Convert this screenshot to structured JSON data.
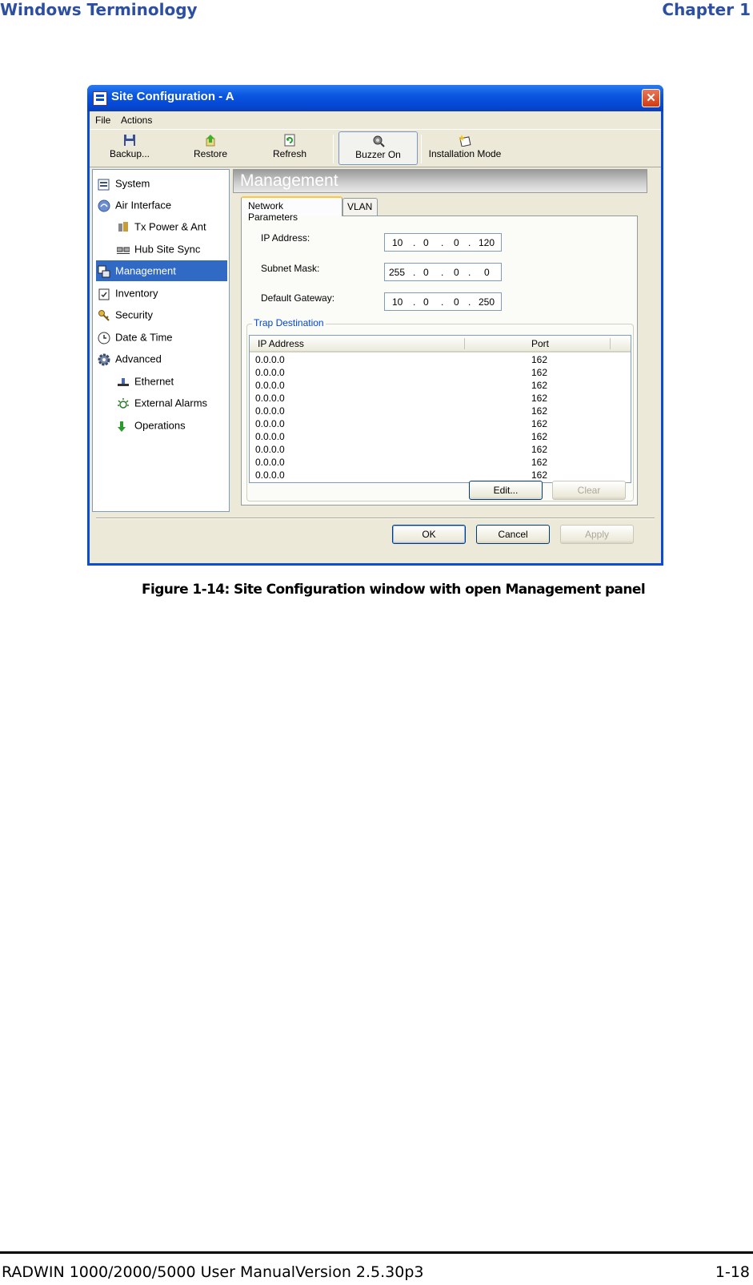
{
  "doc": {
    "header_left": "Windows Terminology",
    "header_right": "Chapter 1",
    "caption": "Figure 1-14: Site Configuration window with open Management panel",
    "footer_left": "RADWIN 1000/2000/5000 User ManualVersion  2.5.30p3",
    "footer_right": "1-18"
  },
  "window": {
    "title": "Site Configuration - A",
    "close_glyph": "✕",
    "menu": [
      "File",
      "Actions"
    ],
    "toolbar": {
      "backup": "Backup...",
      "restore": "Restore",
      "refresh": "Refresh",
      "buzzer": "Buzzer On",
      "installation": "Installation Mode"
    },
    "nav": {
      "system": "System",
      "air_interface": "Air Interface",
      "tx_power": "Tx Power & Ant",
      "hub_site_sync": "Hub Site Sync",
      "management": "Management",
      "inventory": "Inventory",
      "security": "Security",
      "date_time": "Date & Time",
      "advanced": "Advanced",
      "ethernet": "Ethernet",
      "external_alarms": "External Alarms",
      "operations": "Operations"
    },
    "panel_title": "Management",
    "tabs": {
      "network": "Network Parameters",
      "vlan": "VLAN"
    },
    "fields": {
      "ip_label": "IP Address:",
      "ip": [
        "10",
        "0",
        "0",
        "120"
      ],
      "mask_label": "Subnet Mask:",
      "mask": [
        "255",
        "0",
        "0",
        "0"
      ],
      "gw_label": "Default Gateway:",
      "gw": [
        "10",
        "0",
        "0",
        "250"
      ],
      "dot": "."
    },
    "trap": {
      "legend": "Trap Destination",
      "col_ip": "IP Address",
      "col_port": "Port",
      "rows": [
        {
          "ip": "0.0.0.0",
          "port": "162"
        },
        {
          "ip": "0.0.0.0",
          "port": "162"
        },
        {
          "ip": "0.0.0.0",
          "port": "162"
        },
        {
          "ip": "0.0.0.0",
          "port": "162"
        },
        {
          "ip": "0.0.0.0",
          "port": "162"
        },
        {
          "ip": "0.0.0.0",
          "port": "162"
        },
        {
          "ip": "0.0.0.0",
          "port": "162"
        },
        {
          "ip": "0.0.0.0",
          "port": "162"
        },
        {
          "ip": "0.0.0.0",
          "port": "162"
        },
        {
          "ip": "0.0.0.0",
          "port": "162"
        }
      ],
      "edit": "Edit...",
      "clear": "Clear"
    },
    "buttons": {
      "ok": "OK",
      "cancel": "Cancel",
      "apply": "Apply"
    }
  }
}
